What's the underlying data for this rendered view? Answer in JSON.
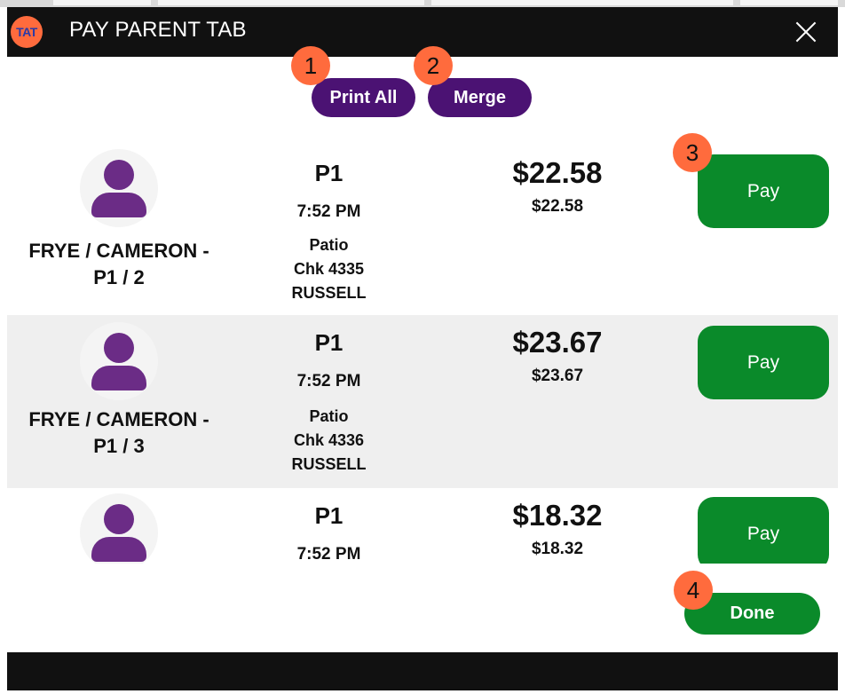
{
  "header": {
    "logo_text": "TAT",
    "title": "PAY PARENT TAB"
  },
  "toolbar": {
    "print_all_label": "Print All",
    "merge_label": "Merge"
  },
  "badges": [
    "1",
    "2",
    "3",
    "4"
  ],
  "checks": [
    {
      "name_line1": "FRYE / CAMERON -",
      "name_line2": "P1 / 2",
      "seat": "P1",
      "time": "7:52 PM",
      "area": "Patio",
      "check": "Chk 4335",
      "server": "RUSSELL",
      "amount": "$22.58",
      "amount_sub": "$22.58",
      "pay_label": "Pay"
    },
    {
      "name_line1": "FRYE / CAMERON -",
      "name_line2": "P1 / 3",
      "seat": "P1",
      "time": "7:52 PM",
      "area": "Patio",
      "check": "Chk 4336",
      "server": "RUSSELL",
      "amount": "$23.67",
      "amount_sub": "$23.67",
      "pay_label": "Pay"
    },
    {
      "seat": "P1",
      "time": "7:52 PM",
      "amount": "$18.32",
      "amount_sub": "$18.32",
      "pay_label": "Pay"
    }
  ],
  "done_label": "Done",
  "colors": {
    "header_bg": "#111111",
    "accent_purple": "#4b1273",
    "pay_green": "#0a8a2a",
    "badge_orange": "#ff6b3d",
    "avatar_purple": "#6b2c86"
  }
}
